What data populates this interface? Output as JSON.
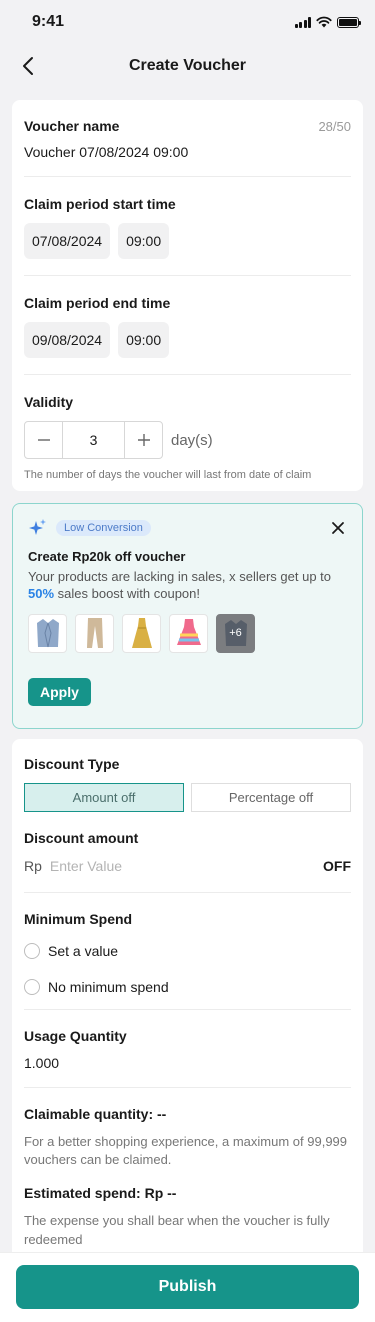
{
  "status_bar": {
    "time": "9:41"
  },
  "header": {
    "title": "Create Voucher",
    "back_icon": "chevron-left-icon"
  },
  "voucher_name": {
    "label": "Voucher name",
    "value": "Voucher 07/08/2024 09:00",
    "counter": "28/50"
  },
  "claim_start": {
    "label": "Claim period start time",
    "date": "07/08/2024",
    "time": "09:00"
  },
  "claim_end": {
    "label": "Claim period end time",
    "date": "09/08/2024",
    "time": "09:00"
  },
  "validity": {
    "label": "Validity",
    "value": "3",
    "unit": "day(s)",
    "helper": "The number of days the voucher will last from date of claim"
  },
  "promo": {
    "badge": "Low Conversion",
    "title": "Create Rp20k off voucher",
    "desc_before": "Your products are lacking in sales, x sellers get up to ",
    "desc_highlight": "50%",
    "desc_after": " sales boost with coupon!",
    "more_count": "+6",
    "apply_label": "Apply",
    "accent": "#16948a"
  },
  "discount_type": {
    "label": "Discount Type",
    "options": [
      "Amount off",
      "Percentage off"
    ],
    "selected": "Amount off"
  },
  "discount_amount": {
    "label": "Discount amount",
    "prefix": "Rp",
    "placeholder": "Enter Value",
    "suffix": "OFF"
  },
  "minimum_spend": {
    "label": "Minimum Spend",
    "options": [
      "Set a value",
      "No minimum spend"
    ]
  },
  "usage_quantity": {
    "label": "Usage Quantity",
    "value": "1.000"
  },
  "claimable": {
    "label": "Claimable quantity: --",
    "text": "For a better shopping experience, a maximum of 99,999 vouchers can be claimed."
  },
  "estimated": {
    "label": "Estimated spend: Rp --",
    "text": "The expense you shall bear when the voucher is fully redeemed"
  },
  "footer": {
    "publish_label": "Publish"
  }
}
